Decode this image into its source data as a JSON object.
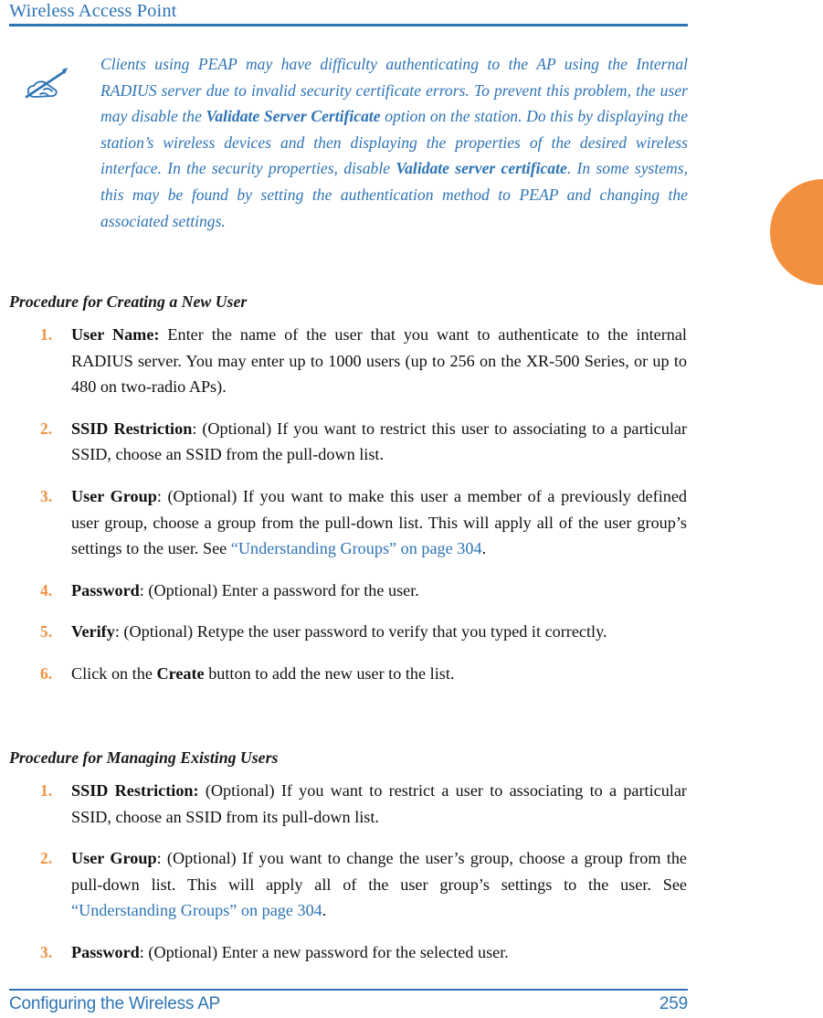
{
  "header": {
    "title": "Wireless Access Point",
    "rule_color": "#2E74B5"
  },
  "edge_tab": {
    "name": "chapter-thumb-tab",
    "color": "#F3903F"
  },
  "note": {
    "icon": "note-writing-hand-icon",
    "color": "#2E74B5",
    "text_part1": "Clients using PEAP may have difficulty authenticating to the AP using the Internal RADIUS server due to invalid security certificate errors. To prevent this problem, the user may disable the ",
    "bold1": "Validate Server Certificate",
    "text_part2": " option on the station. Do this by displaying the station’s wireless devices and then displaying the properties of the desired wireless interface. In the security properties, disable ",
    "bold2": "Validate server certificate",
    "text_part3": ". In some systems, this may be found by setting the authentication method to PEAP and changing the associated settings."
  },
  "section_create": {
    "heading": "Procedure for Creating a New User",
    "items": [
      {
        "num": "1.",
        "lead": "User Name:",
        "text": " Enter the name of the user that you want to authenticate to the internal RADIUS server. You may enter up to 1000 users (up to 256 on the XR-500 Series, or up to 480 on two-radio APs)."
      },
      {
        "num": "2.",
        "lead": "SSID Restriction",
        "text": ": (Optional) If you want to restrict this user to associating to a particular SSID, choose an SSID from the pull-down list."
      },
      {
        "num": "3.",
        "lead": "User Group",
        "text": ": (Optional) If you want to make this user a member of a previously defined user group, choose a group from the pull-down list. This will apply all of the user group’s settings to the user. See ",
        "xref": "“Understanding Groups” on page 304",
        "text_after": "."
      },
      {
        "num": "4.",
        "lead": "Password",
        "text": ": (Optional) Enter a password for the user."
      },
      {
        "num": "5.",
        "lead": "Verify",
        "text": ": (Optional) Retype the user password to verify that you typed it correctly."
      },
      {
        "num": "6.",
        "pre": "Click on the ",
        "lead": "Create",
        "text": " button to add the new user to the list."
      }
    ]
  },
  "section_manage": {
    "heading": "Procedure for Managing Existing Users",
    "items": [
      {
        "num": "1.",
        "lead": "SSID Restriction:",
        "text": " (Optional) If you want to restrict a user to associating to a particular SSID, choose an SSID from its pull-down list."
      },
      {
        "num": "2.",
        "lead": "User Group",
        "text": ": (Optional) If you want to change the user’s group, choose a group from the pull-down list. This will apply all of the user group’s settings to the user. See ",
        "xref": "“Understanding Groups” on page 304",
        "text_after": "."
      },
      {
        "num": "3.",
        "lead": "Password",
        "text": ": (Optional) Enter a new password for the selected user."
      }
    ]
  },
  "footer": {
    "title": "Configuring the Wireless AP",
    "page_number": "259",
    "color": "#2E74B5"
  }
}
